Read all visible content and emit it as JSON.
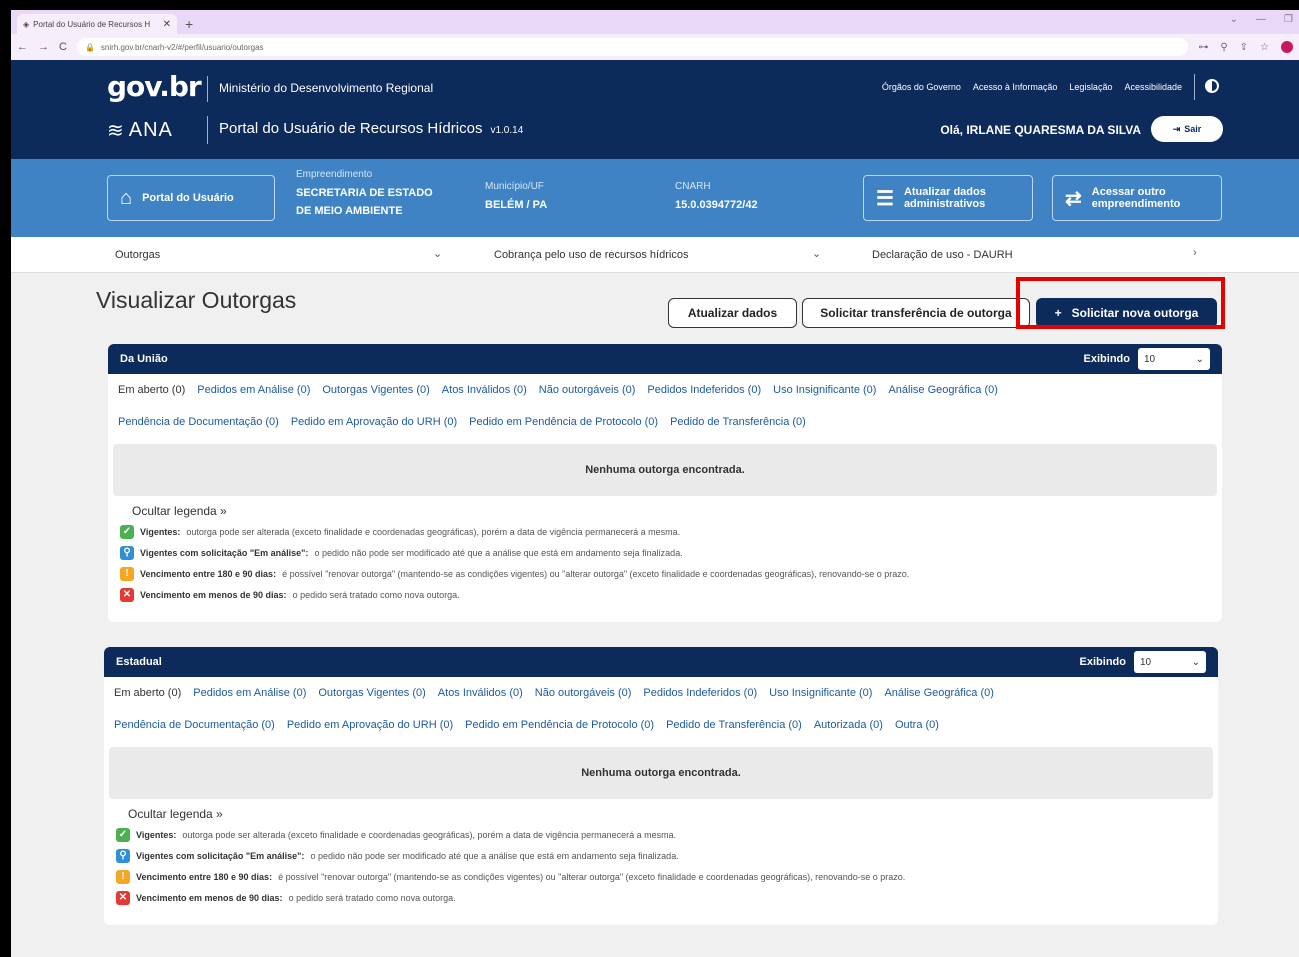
{
  "browser": {
    "tab_title": "Portal do Usuário de Recursos H",
    "url": "snirh.gov.br/cnarh-v2/#/perfil/usuario/outorgas",
    "new_tab": "+",
    "close": "✕"
  },
  "header": {
    "gov_logo": "gov.br",
    "ministry": "Ministério do Desenvolvimento Regional",
    "links": [
      "Órgãos do Governo",
      "Acesso à Informação",
      "Legislação",
      "Acessibilidade"
    ],
    "ana_logo": "ANA",
    "portal_title": "Portal do Usuário de Recursos Hídricos",
    "version": "v1.0.14",
    "greeting": "Olá, IRLANE QUARESMA DA SILVA",
    "logout": "Sair"
  },
  "info": {
    "portal_btn": "Portal do Usuário",
    "empreendimento_label": "Empreendimento",
    "empreendimento_line1": "SECRETARIA DE ESTADO",
    "empreendimento_line2": "DE MEIO AMBIENTE",
    "municipio_label": "Município/UF",
    "municipio_value": "BELÉM / PA",
    "cnarh_label": "CNARH",
    "cnarh_value": "15.0.0394772/42",
    "atualizar_line1": "Atualizar dados",
    "atualizar_line2": "administrativos",
    "acessar_line1": "Acessar outro",
    "acessar_line2": "empreendimento"
  },
  "subnav": {
    "outorgas": "Outorgas",
    "cobranca": "Cobrança pelo uso de recursos hídricos",
    "declaracao": "Declaração de uso - DAURH"
  },
  "main": {
    "title": "Visualizar Outorgas",
    "btn_atualizar": "Atualizar dados",
    "btn_transferencia": "Solicitar transferência de outorga",
    "btn_nova": "Solicitar nova outorga"
  },
  "uniao": {
    "title": "Da União",
    "exibindo_label": "Exibindo",
    "exibindo_value": "10",
    "tabs_row1": [
      "Em aberto (0)",
      "Pedidos em Análise (0)",
      "Outorgas Vigentes (0)",
      "Atos Inválidos (0)",
      "Não outorgáveis (0)",
      "Pedidos Indeferidos (0)",
      "Uso Insignificante (0)",
      "Análise Geográfica (0)"
    ],
    "tabs_row2": [
      "Pendência de Documentação (0)",
      "Pedido em Aprovação do URH (0)",
      "Pedido em Pendência de Protocolo (0)",
      "Pedido de Transferência (0)"
    ],
    "empty": "Nenhuma outorga encontrada."
  },
  "estadual": {
    "title": "Estadual",
    "exibindo_label": "Exibindo",
    "exibindo_value": "10",
    "tabs_row1": [
      "Em aberto (0)",
      "Pedidos em Análise (0)",
      "Outorgas Vigentes (0)",
      "Atos Inválidos (0)",
      "Não outorgáveis (0)",
      "Pedidos Indeferidos (0)",
      "Uso Insignificante (0)",
      "Análise Geográfica (0)"
    ],
    "tabs_row2": [
      "Pendência de Documentação (0)",
      "Pedido em Aprovação do URH (0)",
      "Pedido em Pendência de Protocolo (0)",
      "Pedido de Transferência (0)",
      "Autorizada (0)",
      "Outra (0)"
    ],
    "empty": "Nenhuma outorga encontrada."
  },
  "legend": {
    "toggle": "Ocultar legenda »",
    "items": [
      {
        "title": "Vigentes:",
        "text": "outorga pode ser alterada (exceto finalidade e coordenadas geográficas), porém a data de vigência permanecerá a mesma.",
        "color": "#4caf50",
        "icon": "check-icon"
      },
      {
        "title": "Vigentes com solicitação \"Em análise\":",
        "text": "o pedido não pode ser modificado até que a análise que está em andamento seja finalizada.",
        "color": "#2f8fd8",
        "icon": "search-icon"
      },
      {
        "title": "Vencimento entre 180 e 90 dias:",
        "text": "é possível \"renovar outorga\" (mantendo-se as condições vigentes) ou \"alterar outorga\" (exceto finalidade e coordenadas geográficas), renovando-se o prazo.",
        "color": "#f5a623",
        "icon": "alert-icon"
      },
      {
        "title": "Vencimento em menos de 90 dias:",
        "text": "o pedido será tratado como nova outorga.",
        "color": "#e53935",
        "icon": "x-icon"
      }
    ]
  }
}
